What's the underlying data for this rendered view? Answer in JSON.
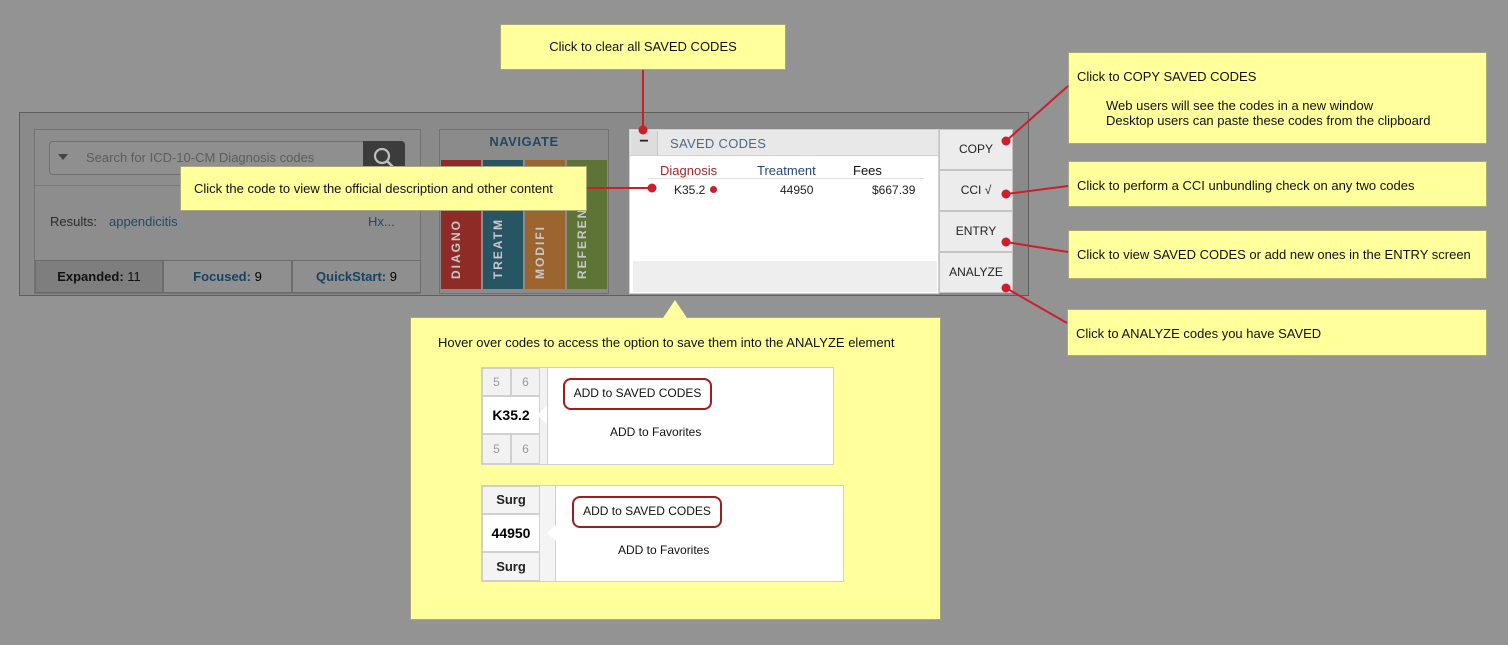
{
  "search": {
    "placeholder": "Search for ICD-10-CM Diagnosis codes"
  },
  "results": {
    "label": "Results:",
    "term": "appendicitis",
    "hx": "Hx..."
  },
  "tabs": [
    {
      "label": "Expanded:",
      "count": "11"
    },
    {
      "label": "Focused:",
      "count": "9"
    },
    {
      "label": "QuickStart:",
      "count": "9"
    }
  ],
  "navigate": {
    "title": "NAVIGATE",
    "columns": [
      {
        "label": "DIAGNO",
        "color": "#b7332b"
      },
      {
        "label": "TREATM",
        "color": "#2b6a7e"
      },
      {
        "label": "MODIFI",
        "color": "#c27a2a"
      },
      {
        "label": "REFERENC",
        "color": "#6f8f3a"
      }
    ]
  },
  "saved": {
    "title": "SAVED CODES",
    "minus": "−",
    "headers": {
      "diagnosis": "Diagnosis",
      "treatment": "Treatment",
      "fees": "Fees"
    },
    "row": {
      "diagnosis": "K35.2",
      "treatment": "44950",
      "fees": "$667.39"
    }
  },
  "side_buttons": {
    "copy": "COPY",
    "cci": "CCI √",
    "entry": "ENTRY",
    "analyze": "ANALYZE"
  },
  "notes": {
    "clear": "Click to clear all SAVED CODES",
    "code": "Click the code to view the official description and other content",
    "copy_title": "Click to COPY SAVED CODES",
    "copy_line1": "Web users will see the codes in a new window",
    "copy_line2": "Desktop users can paste these codes from the clipboard",
    "cci": "Click to perform a CCI unbundling check on any two codes",
    "entry": "Click to view SAVED CODES or add new ones in the ENTRY screen",
    "analyze": "Click to ANALYZE codes you have SAVED",
    "hover": "Hover over codes to access the option to save them into the ANALYZE element"
  },
  "example1": {
    "top": [
      "5",
      "6"
    ],
    "code": "K35.2",
    "bottom": [
      "5",
      "6"
    ],
    "add_saved": "ADD to SAVED CODES",
    "add_fav": "ADD to Favorites"
  },
  "example2": {
    "top": "Surg",
    "code": "44950",
    "bottom": "Surg",
    "add_saved": "ADD to SAVED CODES",
    "add_fav": "ADD to Favorites"
  },
  "colors": {
    "annotation_red": "#cc1f2a",
    "note_bg": "#ffff9c",
    "link_blue": "#1e4a66"
  }
}
